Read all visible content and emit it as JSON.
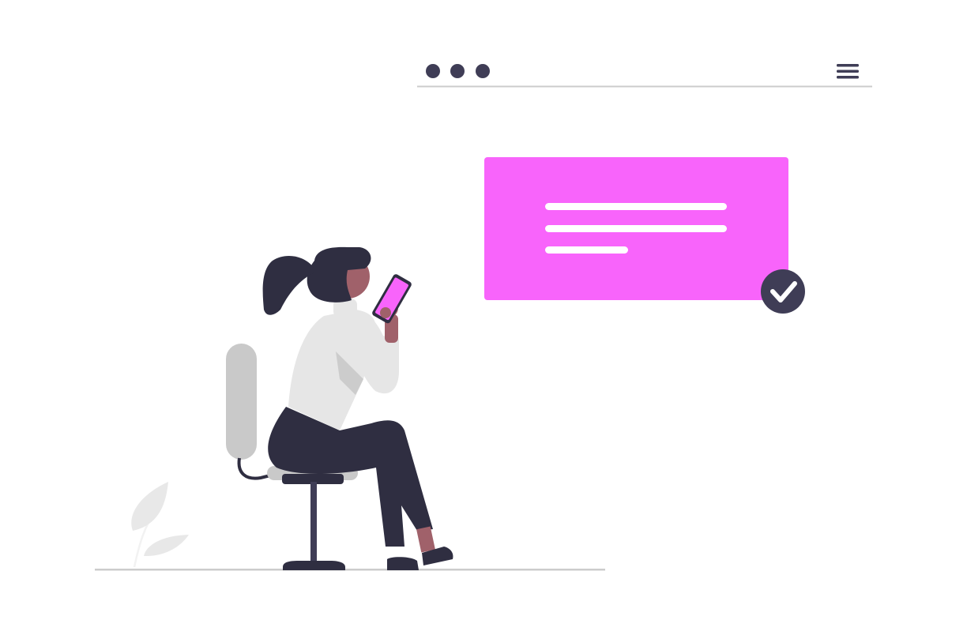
{
  "colors": {
    "accent": "#f864fb",
    "dark": "#2f2e41",
    "skin": "#a0616a",
    "light_gray": "#e6e6e6",
    "mid_gray": "#cccccc",
    "chair_gray": "#c9c9c9",
    "white": "#ffffff"
  },
  "browser": {
    "window_dots": [
      "dot-1",
      "dot-2",
      "dot-3"
    ],
    "menu_icon": "hamburger-menu-icon"
  },
  "message_card": {
    "line_count": 3,
    "status_icon": "checkmark-circle-icon"
  }
}
